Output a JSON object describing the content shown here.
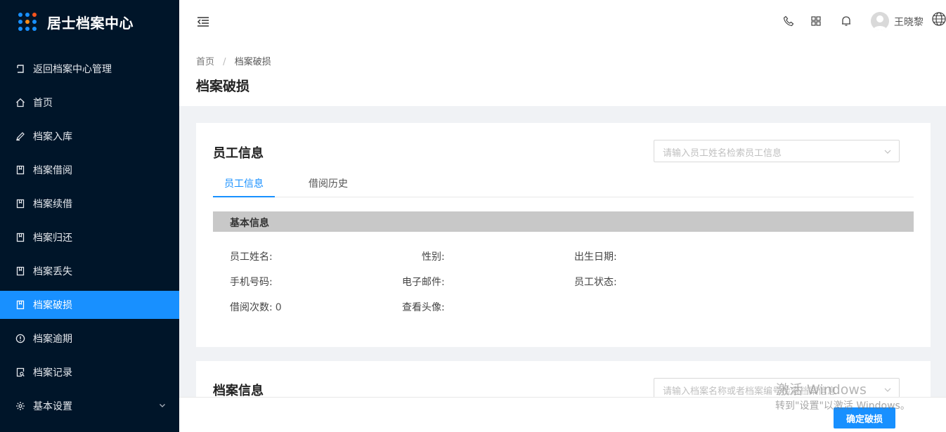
{
  "app": {
    "title": "居士档案中心"
  },
  "sidebar": {
    "items": [
      {
        "label": "返回档案中心管理",
        "icon": "return-icon"
      },
      {
        "label": "首页",
        "icon": "home-icon"
      },
      {
        "label": "档案入库",
        "icon": "pen-icon"
      },
      {
        "label": "档案借阅",
        "icon": "book-icon"
      },
      {
        "label": "档案续借",
        "icon": "book-icon"
      },
      {
        "label": "档案归还",
        "icon": "book-icon"
      },
      {
        "label": "档案丢失",
        "icon": "book-icon"
      },
      {
        "label": "档案破损",
        "icon": "book-icon",
        "active": true
      },
      {
        "label": "档案逾期",
        "icon": "alert-circle-icon"
      },
      {
        "label": "档案记录",
        "icon": "record-search-icon"
      },
      {
        "label": "基本设置",
        "icon": "gear-icon"
      }
    ]
  },
  "header": {
    "user_name": "王晓黎"
  },
  "breadcrumb": {
    "home": "首页",
    "sep": "/",
    "current": "档案破损"
  },
  "page": {
    "title": "档案破损"
  },
  "employee_card": {
    "title": "员工信息",
    "search_placeholder": "请输入员工姓名检索员工信息",
    "tabs": [
      "员工信息",
      "借阅历史"
    ],
    "section_title": "基本信息",
    "fields": {
      "name": "员工姓名:",
      "gender": "性别:",
      "birth": "出生日期:",
      "phone": "手机号码:",
      "email": "电子邮件:",
      "status": "员工状态:",
      "borrow_count_label": "借阅次数:",
      "borrow_count_value": "0",
      "avatar": "查看头像:"
    }
  },
  "archive_card": {
    "title": "档案信息",
    "search_placeholder": "请输入档案名称或者档案编号检索档案信息"
  },
  "footer": {
    "confirm_label": "确定破损"
  },
  "watermark": {
    "line1": "激活 Windows",
    "line2": "转到\"设置\"以激活 Windows。"
  },
  "colors": {
    "sidebar_bg": "#001529",
    "accent": "#1890ff",
    "section_bar": "#c8c8c8"
  }
}
